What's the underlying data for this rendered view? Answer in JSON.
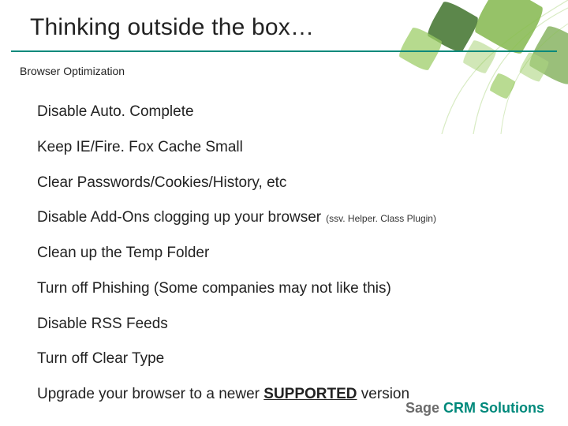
{
  "title": "Thinking outside the box…",
  "subtitle": "Browser Optimization",
  "items": [
    {
      "text": "Disable Auto. Complete"
    },
    {
      "text": "Keep IE/Fire. Fox Cache Small"
    },
    {
      "text": "Clear Passwords/Cookies/History, etc"
    },
    {
      "text": "Disable Add-Ons clogging up your browser",
      "note": "(ssv. Helper. Class Plugin)"
    },
    {
      "text": "Clean up the Temp Folder"
    },
    {
      "text": "Turn off Phishing (Some companies may not like this)"
    },
    {
      "text": "Disable RSS Feeds"
    },
    {
      "text": "Turn off Clear Type"
    },
    {
      "text_pre": "Upgrade your browser to a newer ",
      "supported": "SUPPORTED",
      "text_post": " version"
    }
  ],
  "brand": {
    "sage": "Sage ",
    "crm": "CRM Solutions"
  },
  "colors": {
    "accent": "#00897b"
  }
}
